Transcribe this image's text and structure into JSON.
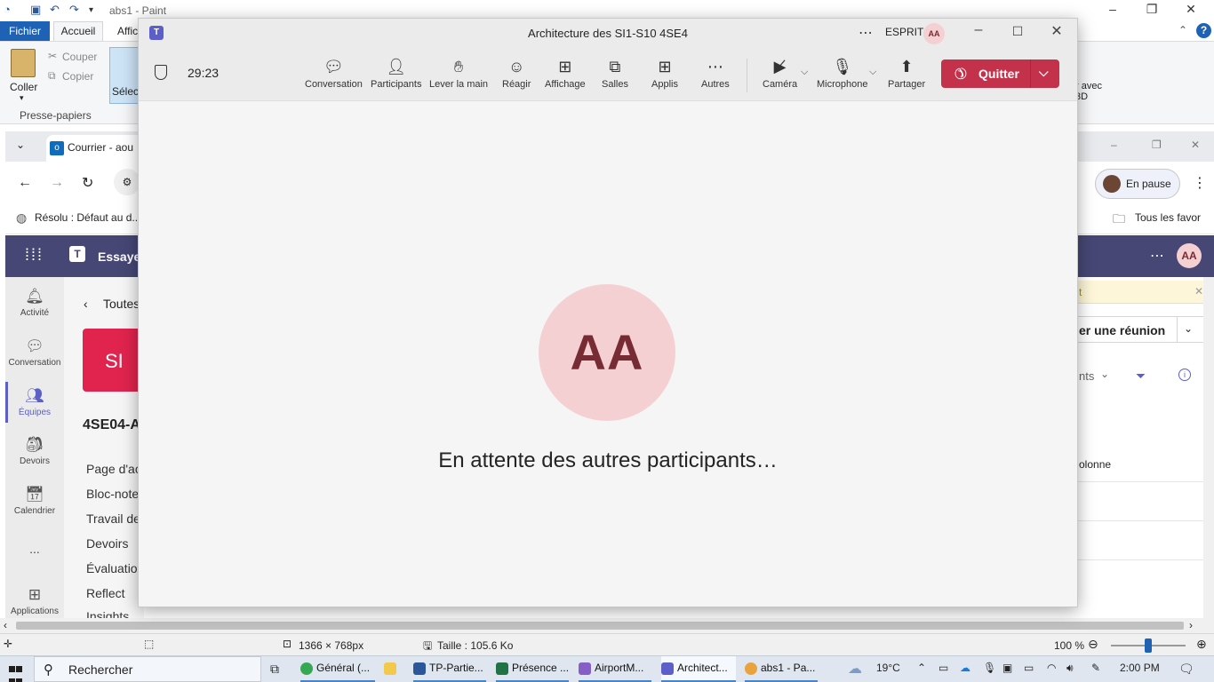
{
  "paint": {
    "title": "abs1 - Paint",
    "tabs": [
      "Fichier",
      "Accueil",
      "Affichage"
    ],
    "clipboard": {
      "paste": "Coller",
      "cut": "Couper",
      "copy": "Copier",
      "group": "Presse-papiers"
    },
    "select_label": "Sélect",
    "right_clip_label": "r avec",
    "right_clip_label2": "3D",
    "status": {
      "dimensions": "1366 × 768px",
      "size": "Taille : 105.6 Ko",
      "zoom": "100 %"
    }
  },
  "edge": {
    "tab_title": "Courrier - aou",
    "fav_item": "Résolu : Défaut au d...",
    "fav_all": "Tous les favor",
    "pause_label": "En pause"
  },
  "teams_bg": {
    "header_text": "Essayez",
    "avatar_initials": "AA",
    "rail": [
      "Activité",
      "Conversation",
      "Équipes",
      "Devoirs",
      "Calendrier",
      "...",
      "Applications"
    ],
    "back_label": "Toutes",
    "team_tile": "SI",
    "team_name": "4SE04-A",
    "channels": [
      "Page d'ac",
      "Bloc-note",
      "Travail de",
      "Devoirs",
      "Évaluation",
      "Reflect",
      "Insights"
    ],
    "right_meeting_btn": "er une réunion",
    "right_filter_label": "nts",
    "right_column_label": "olonne",
    "yellow_bar_text": "t"
  },
  "meeting": {
    "title": "Architecture des SI1-S10 4SE4",
    "org": "ESPRIT",
    "avatar_initials": "AA",
    "timer": "29:23",
    "toolbar": [
      {
        "label": "Conversation",
        "icon": "chat-icon"
      },
      {
        "label": "Participants",
        "icon": "people-icon"
      },
      {
        "label": "Lever la main",
        "icon": "hand-icon"
      },
      {
        "label": "Réagir",
        "icon": "smiley-icon"
      },
      {
        "label": "Affichage",
        "icon": "grid-icon"
      },
      {
        "label": "Salles",
        "icon": "rooms-icon"
      },
      {
        "label": "Applis",
        "icon": "add-app-icon"
      },
      {
        "label": "Autres",
        "icon": "more-icon"
      }
    ],
    "camera_label": "Caméra",
    "mic_label": "Microphone",
    "share_label": "Partager",
    "leave_label": "Quitter",
    "waiting_text": "En attente des autres participants…",
    "brand_color": "#c4314b"
  },
  "taskbar": {
    "search": "Rechercher",
    "apps": [
      "Général (...",
      "TP-Partie...",
      "Présence ...",
      "AirportM...",
      "Architect...",
      "abs1 - Pa..."
    ],
    "temperature": "19°C",
    "time": "2:00 PM"
  }
}
